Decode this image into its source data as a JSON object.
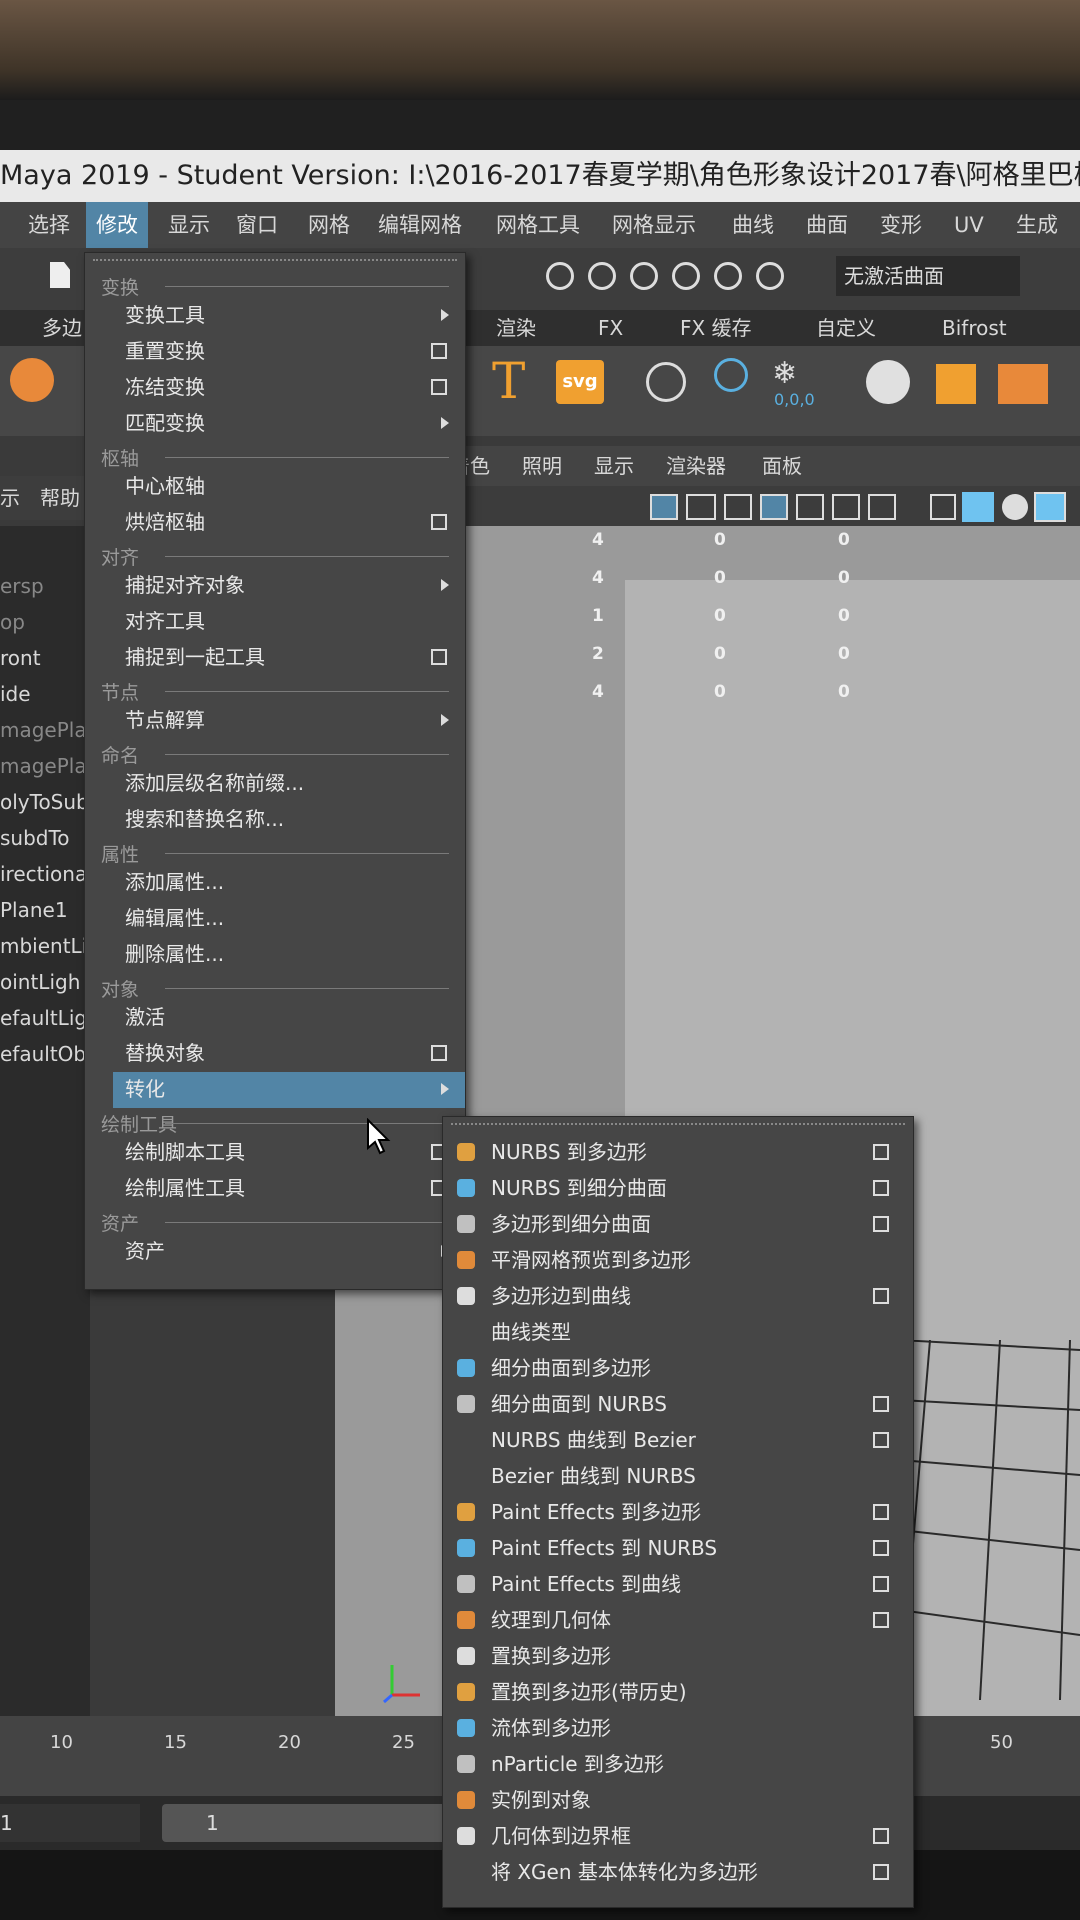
{
  "window": {
    "title": "Maya 2019 - Student Version: I:\\2016-2017春夏学期\\角色形象设计2017春\\阿格里巴样"
  },
  "menubar": [
    "选择",
    "修改",
    "显示",
    "窗口",
    "网格",
    "编辑网格",
    "网格工具",
    "网格显示",
    "曲线",
    "曲面",
    "变形",
    "UV",
    "生成"
  ],
  "toolbar": {
    "surface_label": "无激活曲面"
  },
  "shelf_tabs": [
    "多边",
    "渲染",
    "FX",
    "FX 缓存",
    "自定义",
    "Bifrost"
  ],
  "shelf": {
    "text_tool": "T",
    "svg_tool": "svg",
    "snow_readout": "0,0,0"
  },
  "panel_menu": [
    "着色",
    "照明",
    "显示",
    "渲染器",
    "面板"
  ],
  "left_help": [
    "示",
    "帮助"
  ],
  "outliner": [
    "ersp",
    "op",
    "ront",
    "ide",
    "magePla",
    "magePla",
    "olyToSub",
    "subdTo",
    "irectiona",
    "Plane1",
    "mbientLi",
    "ointLigh",
    "efaultLig",
    "efaultOb"
  ],
  "heads_up": [
    [
      "4",
      "0",
      "0"
    ],
    [
      "4",
      "0",
      "0"
    ],
    [
      "1",
      "0",
      "0"
    ],
    [
      "2",
      "0",
      "0"
    ],
    [
      "4",
      "0",
      "0"
    ]
  ],
  "modify_menu": {
    "sections": [
      {
        "header": "变换",
        "items": [
          {
            "label": "变换工具",
            "arrow": true
          },
          {
            "label": "重置变换",
            "option": true
          },
          {
            "label": "冻结变换",
            "option": true
          },
          {
            "label": "匹配变换",
            "arrow": true
          }
        ]
      },
      {
        "header": "枢轴",
        "items": [
          {
            "label": "中心枢轴"
          },
          {
            "label": "烘焙枢轴",
            "option": true
          }
        ]
      },
      {
        "header": "对齐",
        "items": [
          {
            "label": "捕捉对齐对象",
            "arrow": true
          },
          {
            "label": "对齐工具"
          },
          {
            "label": "捕捉到一起工具",
            "option": true
          }
        ]
      },
      {
        "header": "节点",
        "items": [
          {
            "label": "节点解算",
            "arrow": true
          }
        ]
      },
      {
        "header": "命名",
        "items": [
          {
            "label": "添加层级名称前缀..."
          },
          {
            "label": "搜索和替换名称..."
          }
        ]
      },
      {
        "header": "属性",
        "items": [
          {
            "label": "添加属性..."
          },
          {
            "label": "编辑属性..."
          },
          {
            "label": "删除属性..."
          }
        ]
      },
      {
        "header": "对象",
        "items": [
          {
            "label": "激活"
          },
          {
            "label": "替换对象",
            "option": true
          },
          {
            "label": "转化",
            "arrow": true,
            "highlight": true
          }
        ]
      },
      {
        "header": "绘制工具",
        "items": [
          {
            "label": "绘制脚本工具",
            "option": true
          },
          {
            "label": "绘制属性工具",
            "option": true
          }
        ]
      },
      {
        "header": "资产",
        "items": [
          {
            "label": "资产",
            "arrow": true
          }
        ]
      }
    ]
  },
  "convert_menu": [
    {
      "label": "NURBS 到多边形",
      "option": true,
      "icon": "nurbs-to-poly-icon"
    },
    {
      "label": "NURBS 到细分曲面",
      "option": true,
      "icon": "nurbs-to-subd-icon"
    },
    {
      "label": "多边形到细分曲面",
      "option": true,
      "icon": "poly-to-subd-icon"
    },
    {
      "label": "平滑网格预览到多边形",
      "icon": "smooth-preview-icon"
    },
    {
      "label": "多边形边到曲线",
      "option": true,
      "icon": "edge-to-curve-icon"
    },
    {
      "label": "曲线类型"
    },
    {
      "label": "细分曲面到多边形",
      "icon": "subd-to-poly-icon"
    },
    {
      "label": "细分曲面到 NURBS",
      "option": true,
      "icon": "subd-to-nurbs-icon"
    },
    {
      "label": "NURBS 曲线到 Bezier",
      "option": true
    },
    {
      "label": "Bezier 曲线到 NURBS"
    },
    {
      "label": "Paint Effects 到多边形",
      "option": true,
      "icon": "paint-effects-poly-icon"
    },
    {
      "label": "Paint Effects 到 NURBS",
      "option": true,
      "icon": "paint-effects-nurbs-icon"
    },
    {
      "label": "Paint Effects 到曲线",
      "option": true,
      "icon": "paint-effects-curve-icon"
    },
    {
      "label": "纹理到几何体",
      "option": true,
      "icon": "texture-to-geo-icon"
    },
    {
      "label": "置换到多边形",
      "icon": "displace-poly-icon"
    },
    {
      "label": "置换到多边形(带历史)",
      "icon": "displace-history-icon"
    },
    {
      "label": "流体到多边形",
      "icon": "fluid-poly-icon"
    },
    {
      "label": "nParticle 到多边形",
      "icon": "nparticle-poly-icon"
    },
    {
      "label": "实例到对象",
      "icon": "instance-object-icon"
    },
    {
      "label": "几何体到边界框",
      "option": true,
      "icon": "bbox-icon"
    },
    {
      "label": "将 XGen 基本体转化为多边形",
      "option": true
    }
  ],
  "timeline": [
    "10",
    "15",
    "20",
    "25",
    "50"
  ],
  "range": {
    "start": "1",
    "current": "1"
  }
}
